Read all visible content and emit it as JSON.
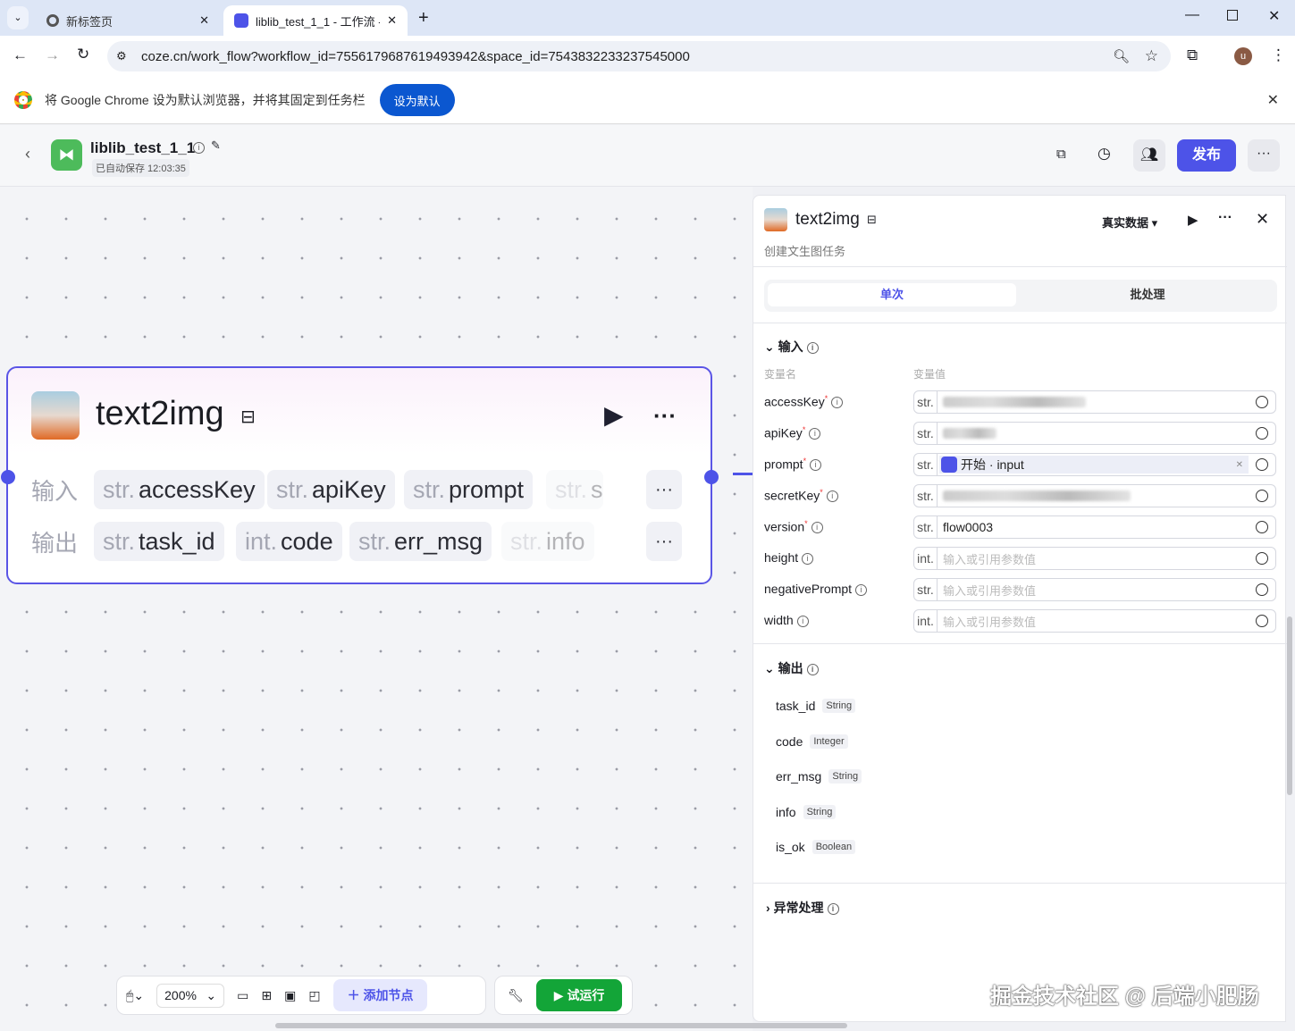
{
  "browser": {
    "tabs": [
      {
        "label": "新标签页"
      },
      {
        "label": "liblib_test_1_1 - 工作流 -"
      }
    ],
    "url": "coze.cn/work_flow?workflow_id=7556179687619493942&space_id=7543832233237545000",
    "profile": "u"
  },
  "infobar": {
    "message": "将 Google Chrome 设为默认浏览器，并将其固定到任务栏",
    "button": "设为默认"
  },
  "header": {
    "title": "liblib_test_1_1",
    "saved": "已自动保存 12:03:35",
    "publish": "发布"
  },
  "node": {
    "title": "text2img",
    "input_label": "输入",
    "output_label": "输出",
    "inputs": [
      {
        "type": "str.",
        "name": "accessKey"
      },
      {
        "type": "str.",
        "name": "apiKey"
      },
      {
        "type": "str.",
        "name": "prompt"
      },
      {
        "type": "str.",
        "name": "s"
      }
    ],
    "outputs": [
      {
        "type": "str.",
        "name": "task_id"
      },
      {
        "type": "int.",
        "name": "code"
      },
      {
        "type": "str.",
        "name": "err_msg"
      },
      {
        "type": "str.",
        "name": "info"
      }
    ],
    "more": "···"
  },
  "panel": {
    "title": "text2img",
    "subtitle": "创建文生图任务",
    "mode": "真实数据",
    "tabs": [
      "单次",
      "批处理"
    ],
    "input_section": "输入",
    "col_name": "变量名",
    "col_value": "变量值",
    "params": [
      {
        "name": "accessKey",
        "required": true,
        "type": "str.",
        "value": "",
        "blurred": true
      },
      {
        "name": "apiKey",
        "required": true,
        "type": "str.",
        "value": "",
        "blurred": true
      },
      {
        "name": "prompt",
        "required": true,
        "type": "str.",
        "ref": "开始 · input"
      },
      {
        "name": "secretKey",
        "required": true,
        "type": "str.",
        "value": "",
        "blurred": true
      },
      {
        "name": "version",
        "required": true,
        "type": "str.",
        "value": "flow0003"
      },
      {
        "name": "height",
        "required": false,
        "type": "int.",
        "placeholder": "输入或引用参数值"
      },
      {
        "name": "negativePrompt",
        "required": false,
        "type": "str.",
        "placeholder": "输入或引用参数值"
      },
      {
        "name": "width",
        "required": false,
        "type": "int.",
        "placeholder": "输入或引用参数值"
      }
    ],
    "output_section": "输出",
    "outputs": [
      {
        "name": "task_id",
        "type": "String"
      },
      {
        "name": "code",
        "type": "Integer"
      },
      {
        "name": "err_msg",
        "type": "String"
      },
      {
        "name": "info",
        "type": "String"
      },
      {
        "name": "is_ok",
        "type": "Boolean"
      }
    ],
    "error_section": "异常处理"
  },
  "toolbar": {
    "zoom": "200%",
    "add_node": "添加节点",
    "run": "试运行"
  },
  "watermark": "掘金技术社区 @ 后端小肥肠"
}
